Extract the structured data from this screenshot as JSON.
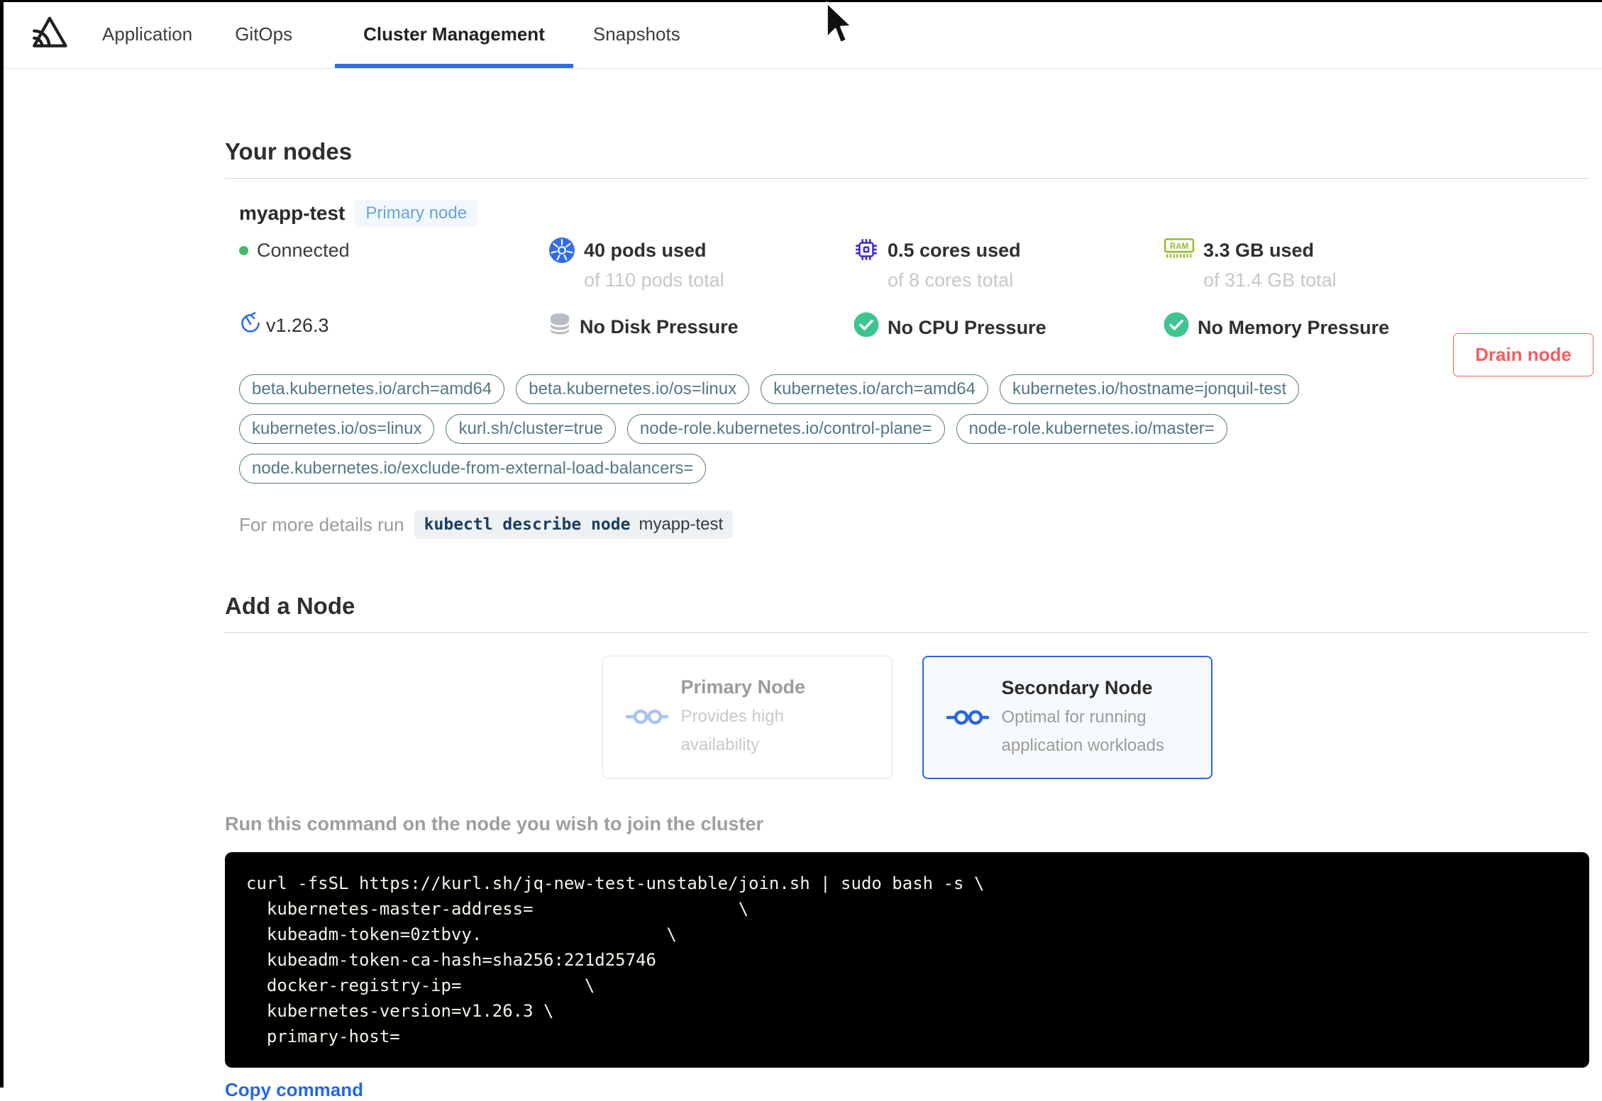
{
  "nav": {
    "tabs": [
      {
        "label": "Application",
        "active": false
      },
      {
        "label": "GitOps",
        "active": false
      },
      {
        "label": "Cluster Management",
        "active": true
      },
      {
        "label": "Snapshots",
        "active": false
      }
    ]
  },
  "your_nodes": {
    "title": "Your nodes",
    "node": {
      "name": "myapp-test",
      "badge": "Primary node",
      "status": "Connected",
      "version": "v1.26.3",
      "pods": {
        "used": "40 pods used",
        "total": "of 110 pods total"
      },
      "cpu": {
        "used": "0.5 cores used",
        "total": "of 8 cores total"
      },
      "memory": {
        "used": "3.3 GB used",
        "total": "of 31.4 GB total"
      },
      "conditions": {
        "disk": "No Disk Pressure",
        "cpu": "No CPU Pressure",
        "memory": "No Memory Pressure"
      },
      "labels": [
        "beta.kubernetes.io/arch=amd64",
        "beta.kubernetes.io/os=linux",
        "kubernetes.io/arch=amd64",
        "kubernetes.io/hostname=jonquil-test",
        "kubernetes.io/os=linux",
        "kurl.sh/cluster=true",
        "node-role.kubernetes.io/control-plane=",
        "node-role.kubernetes.io/master=",
        "node.kubernetes.io/exclude-from-external-load-balancers="
      ],
      "drain_button": "Drain node",
      "details_prefix": "For more details run",
      "details_command": "kubectl describe node",
      "details_node": "myapp-test"
    }
  },
  "add_node": {
    "title": "Add a Node",
    "options": [
      {
        "title": "Primary Node",
        "description": "Provides high availability",
        "selected": false
      },
      {
        "title": "Secondary Node",
        "description": "Optimal for running application workloads",
        "selected": true
      }
    ],
    "instruction": "Run this command on the node you wish to join the cluster",
    "command_lines": [
      "curl -fsSL https://kurl.sh/jq-new-test-unstable/join.sh | sudo bash -s \\",
      "  kubernetes-master-address=                    \\",
      "  kubeadm-token=0ztbvy.                  \\",
      "  kubeadm-token-ca-hash=sha256:221d25746",
      "  docker-registry-ip=            \\",
      "  kubernetes-version=v1.26.3 \\",
      "  primary-host="
    ],
    "copy_link": "Copy command"
  },
  "icons": {
    "logo": "sentry-triangle",
    "pods": "kubernetes-wheel",
    "cpu": "chip",
    "memory": "ram-stick",
    "disk": "database",
    "condition_ok": "check-circle",
    "version": "update-circular-arrow",
    "node_type": "linked-nodes",
    "cursor": "arrow-pointer"
  },
  "colors": {
    "accent_blue": "#2f6ce0",
    "badge_blue": "#69a4da",
    "connected_green": "#45b966",
    "check_green": "#3cc58e",
    "k8s_blue": "#326de6",
    "cpu_indigo": "#3e2dca",
    "ram_green": "#95bd2b",
    "label_teal": "#537884",
    "danger_red": "#f35f5f",
    "link_blue": "#2368e4",
    "code_bg": "#000000"
  }
}
